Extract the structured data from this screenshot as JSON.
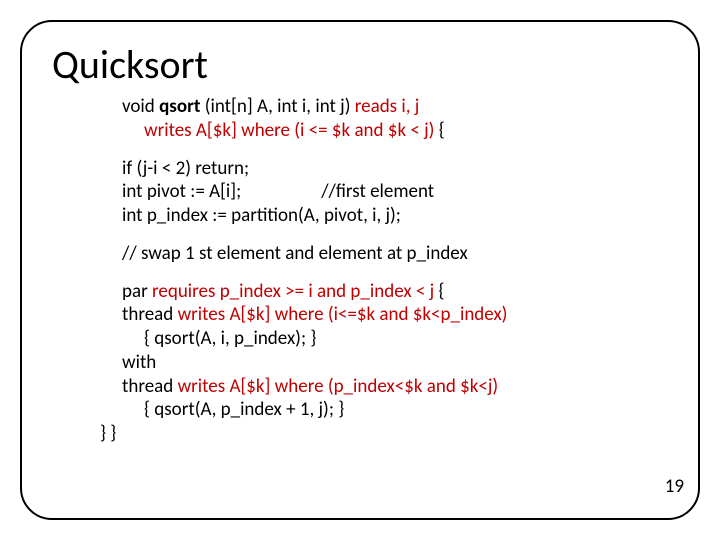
{
  "title": "Quicksort",
  "code": {
    "sig": {
      "void": "void ",
      "qsort": "qsort",
      "params": " (int[n] A, int i, int j) ",
      "reads": "reads i, j"
    },
    "writes_line": {
      "writes": "writes A[$k] where (i <= $k and $k < j)",
      "brace": " {"
    },
    "body1": {
      "l1": "if (j-i < 2) return;",
      "l2a": "int pivot := A[i];",
      "l2b": "//first element",
      "l3": "int p_index := partition(A, pivot, i, j);"
    },
    "comment_swap": "// swap 1 st element and element at p_index",
    "par": {
      "l1a": "par ",
      "l1b": "requires p_index >= i and p_index < j",
      "l1c": " {",
      "l2a": "thread ",
      "l2b": "writes A[$k] where (i<=$k and $k<p_index)",
      "l3": "{ qsort(A, i, p_index); }",
      "l4": "with",
      "l5a": "thread ",
      "l5b": "writes A[$k] where (p_index<$k and $k<j)",
      "l6": "{ qsort(A, p_index + 1, j); }",
      "close": "}  }"
    }
  },
  "page_number": "19"
}
